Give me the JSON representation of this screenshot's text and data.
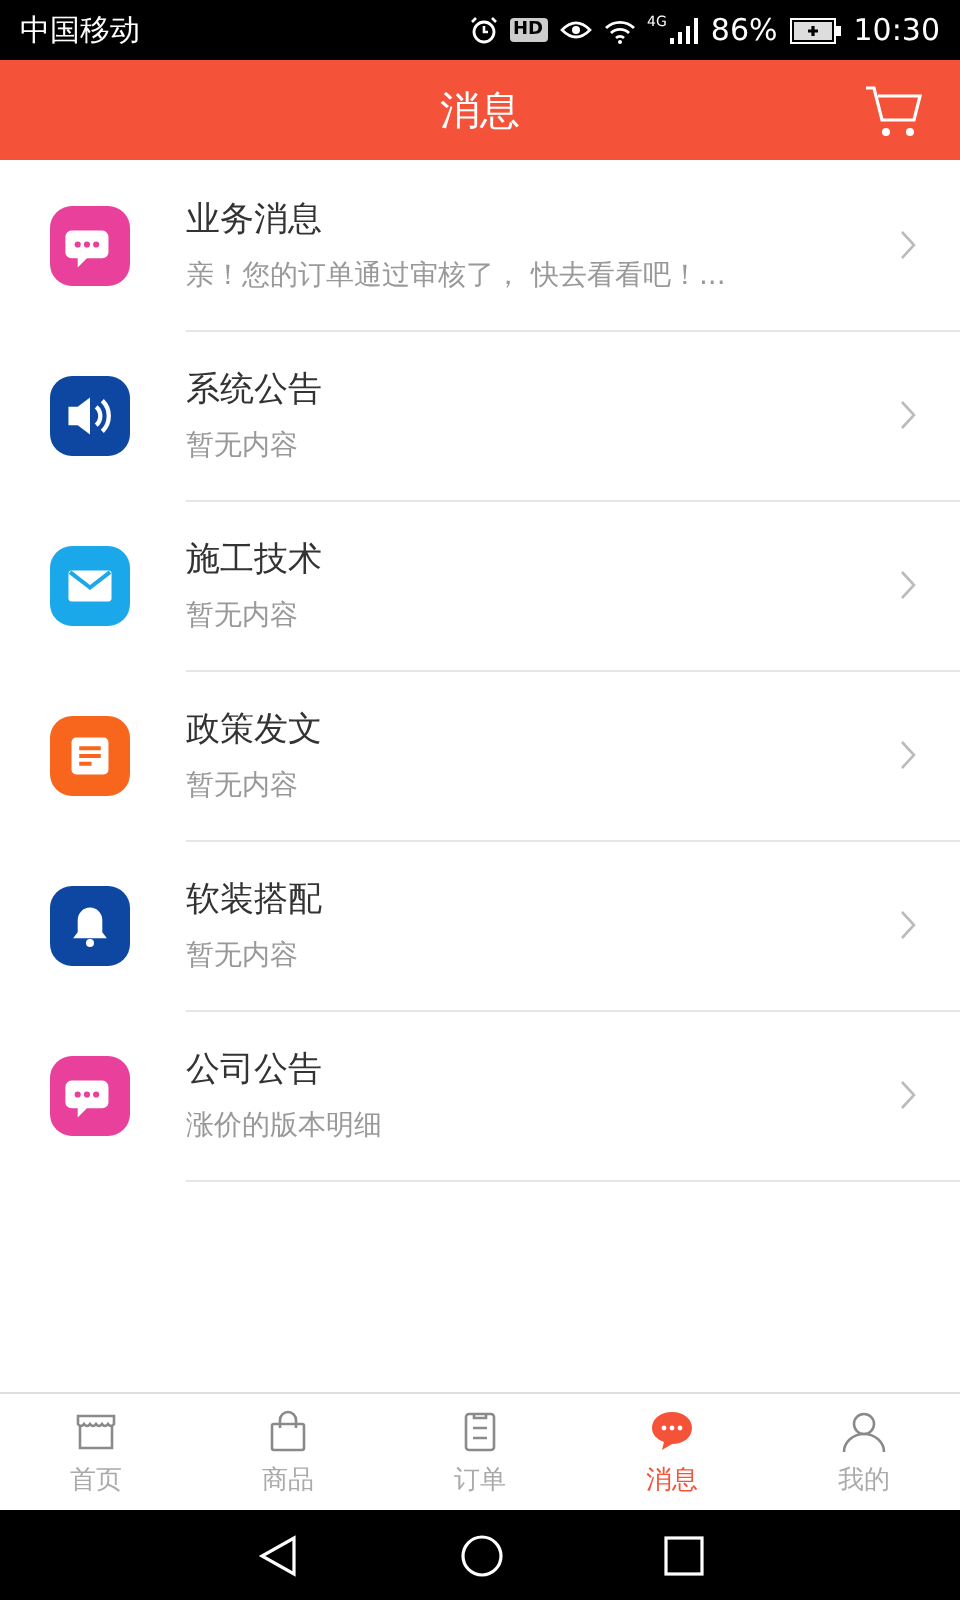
{
  "status_bar": {
    "carrier": "中国移动",
    "hd_badge": "HD",
    "network": "4G",
    "battery": "86%",
    "time": "10:30"
  },
  "header": {
    "title": "消息"
  },
  "messages": [
    {
      "title": "业务消息",
      "preview": "亲！您的订单通过审核了， 快去看看吧！...",
      "kind": "chat",
      "color": "#e8409b"
    },
    {
      "title": "系统公告",
      "preview": "暂无内容",
      "kind": "speaker",
      "color": "#0d47a1"
    },
    {
      "title": "施工技术",
      "preview": "暂无内容",
      "kind": "mail",
      "color": "#1ba8ea"
    },
    {
      "title": "政策发文",
      "preview": "暂无内容",
      "kind": "doc",
      "color": "#f7661c"
    },
    {
      "title": "软装搭配",
      "preview": "暂无内容",
      "kind": "bell",
      "color": "#0d47a1"
    },
    {
      "title": "公司公告",
      "preview": "涨价的版本明细",
      "kind": "chat",
      "color": "#e8409b"
    }
  ],
  "tabs": [
    {
      "label": "首页",
      "kind": "store",
      "selected": false
    },
    {
      "label": "商品",
      "kind": "bag",
      "selected": false
    },
    {
      "label": "订单",
      "kind": "order",
      "selected": false
    },
    {
      "label": "消息",
      "kind": "chat",
      "selected": true
    },
    {
      "label": "我的",
      "kind": "person",
      "selected": false
    }
  ]
}
